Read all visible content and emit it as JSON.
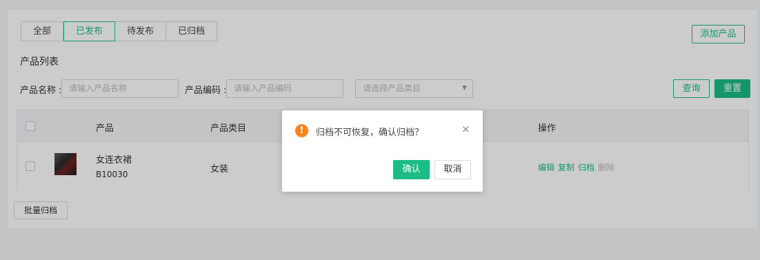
{
  "tabs": [
    {
      "label": "全部",
      "active": false
    },
    {
      "label": "已发布",
      "active": true
    },
    {
      "label": "待发布",
      "active": false
    },
    {
      "label": "已归档",
      "active": false
    }
  ],
  "add_button": "添加产品",
  "section_title": "产品列表",
  "filters": {
    "name_label": "产品名称 :",
    "name_placeholder": "请输入产品名称",
    "code_label": "产品编码 :",
    "code_placeholder": "请输入产品编码",
    "category_placeholder": "请选择产品类目"
  },
  "buttons": {
    "query": "查询",
    "reset": "重置",
    "batch_archive": "批量归档"
  },
  "table": {
    "headers": {
      "product": "产品",
      "category": "产品类目",
      "actions": "操作"
    },
    "rows": [
      {
        "name": "女连衣裙",
        "code": "B10030",
        "category": "女装",
        "actions": [
          {
            "label": "编辑",
            "enabled": true
          },
          {
            "label": "复制",
            "enabled": true
          },
          {
            "label": "归档",
            "enabled": true
          },
          {
            "label": "删除",
            "enabled": false
          }
        ]
      }
    ]
  },
  "dialog": {
    "icon": "warning-icon",
    "message": "归档不可恢复，确认归档？",
    "close": "×",
    "confirm": "确认",
    "cancel": "取消"
  },
  "colors": {
    "accent": "#1dbb85",
    "warning": "#f7841e"
  }
}
